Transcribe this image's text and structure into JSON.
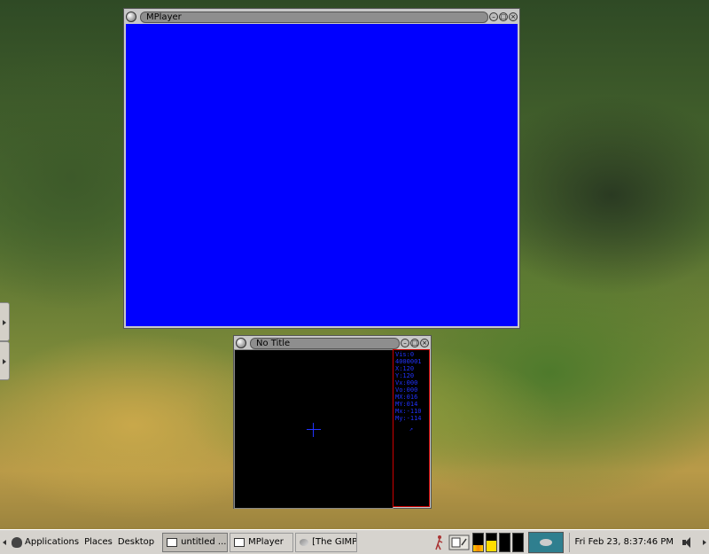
{
  "windows": {
    "mplayer": {
      "title": "MPlayer",
      "video_color": "#0000ff"
    },
    "no_title": {
      "title": "No Title",
      "info_lines": [
        "Vis:0",
        "4000001",
        "X:120",
        "Y:120",
        "Vx:000",
        "Vo:000",
        "MX:016",
        "MY:014",
        "Mx:-110",
        "My:-114"
      ],
      "arrow": "↗"
    }
  },
  "taskbar": {
    "menus": [
      "Applications",
      "Places",
      "Desktop"
    ],
    "tasks": [
      {
        "label": "untitled ...",
        "active": true
      },
      {
        "label": "MPlayer",
        "active": false
      },
      {
        "label": "[The GIMP]",
        "active": false
      }
    ],
    "clock": "Fri Feb 23,  8:37:46 PM"
  },
  "colors": {
    "panel_bg": "#d6d3ce",
    "video": "#0000ff",
    "info_text": "#2233ff",
    "info_border": "#cc0000"
  }
}
